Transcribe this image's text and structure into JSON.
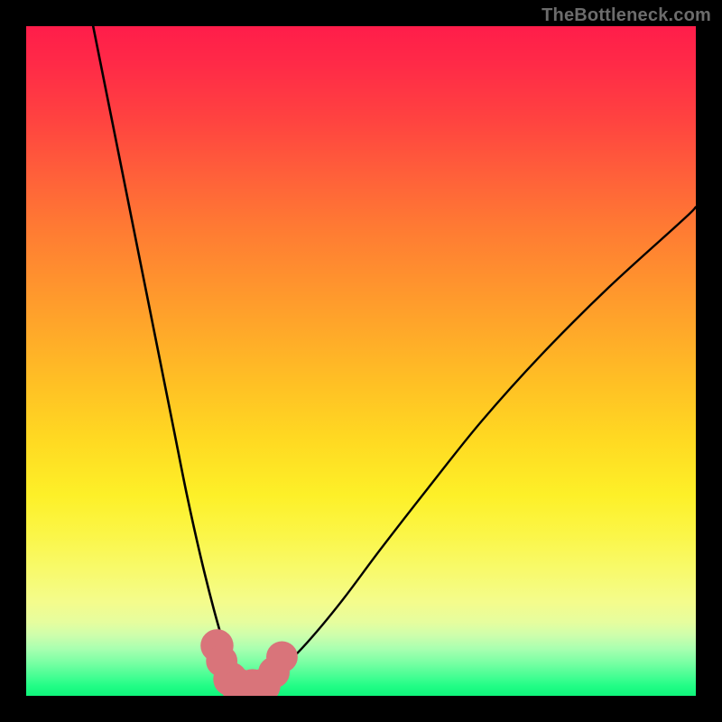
{
  "watermark": "TheBottleneck.com",
  "chart_data": {
    "type": "line",
    "title": "",
    "xlabel": "",
    "ylabel": "",
    "xlim": [
      0,
      100
    ],
    "ylim": [
      0,
      100
    ],
    "grid": false,
    "legend": false,
    "description": "Bottleneck V-curve: two asymmetric curves descending from top edges to a shared minimum in the lower-left-of-center, over a red-to-green vertical gradient background (red = high bottleneck at top, green = low bottleneck near bottom). Pink marker blobs cluster at the curve minimum.",
    "series": [
      {
        "name": "left-curve",
        "x": [
          10,
          12,
          14,
          16,
          18,
          20,
          22,
          24,
          26,
          28,
          30,
          31,
          32,
          33
        ],
        "y": [
          100,
          90,
          80,
          70,
          60,
          50,
          40,
          30,
          21,
          13,
          6,
          3,
          1.5,
          1
        ]
      },
      {
        "name": "right-curve",
        "x": [
          33,
          35,
          38,
          42,
          47,
          53,
          60,
          68,
          77,
          87,
          98,
          100
        ],
        "y": [
          1,
          2,
          4,
          8,
          14,
          22,
          31,
          41,
          51,
          61,
          71,
          73
        ]
      }
    ],
    "markers": [
      {
        "x": 28.5,
        "y": 7.5,
        "r": 1.5,
        "color": "#d9747a"
      },
      {
        "x": 29.2,
        "y": 5.2,
        "r": 1.4,
        "color": "#d9747a"
      },
      {
        "x": 30.5,
        "y": 2.5,
        "r": 1.6,
        "color": "#d9747a"
      },
      {
        "x": 32.0,
        "y": 1.2,
        "r": 1.8,
        "color": "#d9747a"
      },
      {
        "x": 33.8,
        "y": 1.2,
        "r": 1.8,
        "color": "#d9747a"
      },
      {
        "x": 35.4,
        "y": 1.5,
        "r": 1.6,
        "color": "#d9747a"
      },
      {
        "x": 37.0,
        "y": 3.5,
        "r": 1.4,
        "color": "#d9747a"
      },
      {
        "x": 38.2,
        "y": 5.8,
        "r": 1.4,
        "color": "#d9747a"
      }
    ],
    "background_gradient": {
      "top_color": "#ff1d4a",
      "bottom_color": "#0ff57b",
      "meaning": "top = high bottleneck, bottom = no bottleneck"
    }
  }
}
